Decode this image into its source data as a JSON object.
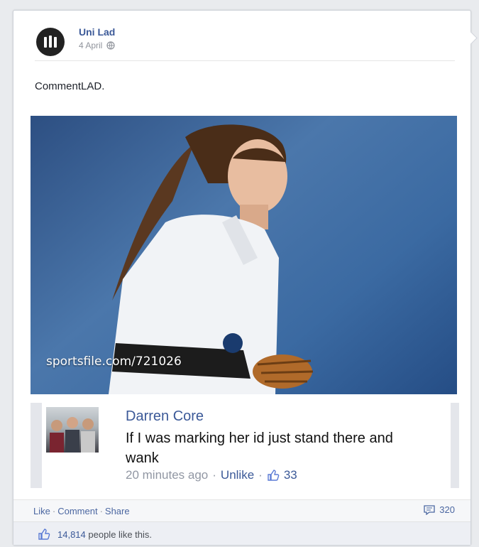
{
  "post": {
    "page_name": "Uni Lad",
    "date": "4 April",
    "privacy_icon": "globe-icon",
    "text": "CommentLAD."
  },
  "photo": {
    "watermark": "sportsfile.com/721026"
  },
  "comment": {
    "author": "Darren Core",
    "text": "If I was marking her id just stand there and wank",
    "time": "20 minutes ago",
    "unlike_label": "Unlike",
    "like_count": "33"
  },
  "actions": {
    "like": "Like",
    "comment": "Comment",
    "share": "Share",
    "comment_count": "320"
  },
  "likes": {
    "count": "14,814",
    "suffix": "people like this."
  },
  "colors": {
    "link": "#3b5998",
    "muted": "#90949c",
    "background": "#e9ebee"
  }
}
